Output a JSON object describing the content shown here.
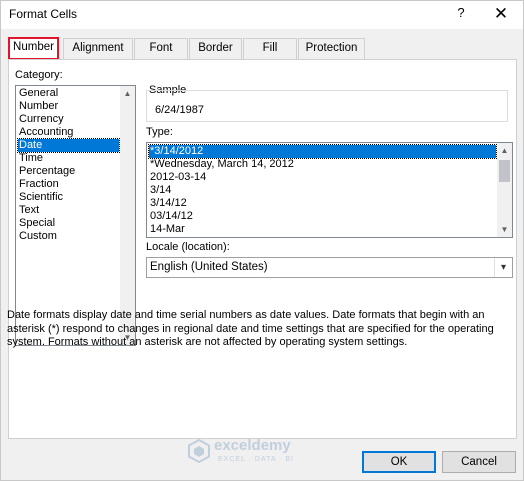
{
  "window": {
    "title": "Format Cells",
    "help_glyph": "?",
    "close_glyph": "✕"
  },
  "tabs": [
    {
      "label": "Number",
      "active": true
    },
    {
      "label": "Alignment",
      "active": false
    },
    {
      "label": "Font",
      "active": false
    },
    {
      "label": "Border",
      "active": false
    },
    {
      "label": "Fill",
      "active": false
    },
    {
      "label": "Protection",
      "active": false
    }
  ],
  "category": {
    "label": "Category:",
    "items": [
      "General",
      "Number",
      "Currency",
      "Accounting",
      "Date",
      "Time",
      "Percentage",
      "Fraction",
      "Scientific",
      "Text",
      "Special",
      "Custom"
    ],
    "selected": "Date"
  },
  "sample": {
    "label": "Sample",
    "value": "6/24/1987"
  },
  "type": {
    "label": "Type:",
    "items": [
      "*3/14/2012",
      "*Wednesday, March 14, 2012",
      "2012-03-14",
      "3/14",
      "3/14/12",
      "03/14/12",
      "14-Mar"
    ],
    "selected": "*3/14/2012"
  },
  "locale": {
    "label": "Locale (location):",
    "value": "English (United States)"
  },
  "description": "Date formats display date and time serial numbers as date values.  Date formats that begin with an asterisk (*) respond to changes in regional date and time settings that are specified for the operating system. Formats without an asterisk are not affected by operating system settings.",
  "buttons": {
    "ok": "OK",
    "cancel": "Cancel"
  },
  "watermark": {
    "name": "exceldemy",
    "tagline": "EXCEL · DATA · BI"
  },
  "colors": {
    "selection": "#0078d7",
    "active_tab_border": "#e0142c"
  }
}
